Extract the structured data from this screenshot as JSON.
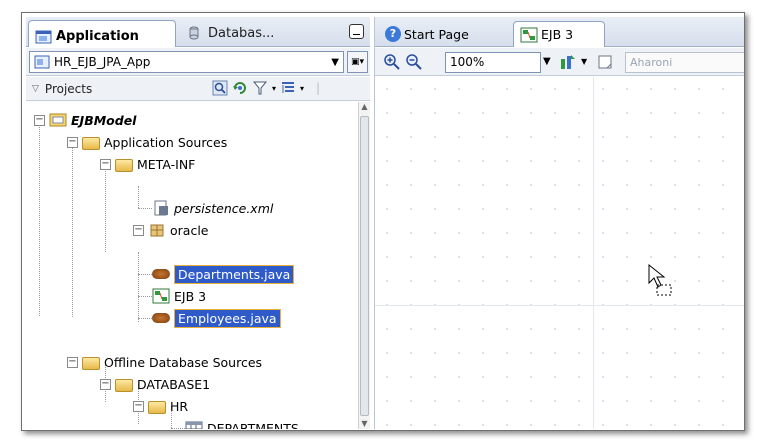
{
  "left_panel": {
    "tabs": [
      {
        "label": "Application",
        "active": true
      },
      {
        "label": "Databas...",
        "active": false
      }
    ],
    "application_select": {
      "value": "HR_EJB_JPA_App"
    },
    "projects_label": "Projects",
    "tree": [
      {
        "label": "EJBModel",
        "depth": 0,
        "expand": "−",
        "icon": "project-icon"
      },
      {
        "label": "Application Sources",
        "depth": 1,
        "expand": "−",
        "icon": "folder-icon"
      },
      {
        "label": "META-INF",
        "depth": 2,
        "expand": "−",
        "icon": "folder-icon"
      },
      {
        "label": "persistence.xml",
        "depth": 3,
        "expand": "",
        "icon": "xml-file-icon"
      },
      {
        "label": "oracle",
        "depth": 2,
        "expand": "−",
        "icon": "package-icon"
      },
      {
        "label": "Departments.java",
        "depth": 3,
        "expand": "",
        "icon": "bean-icon",
        "selected": true
      },
      {
        "label": "EJB 3",
        "depth": 3,
        "expand": "",
        "icon": "diagram-icon"
      },
      {
        "label": "Employees.java",
        "depth": 3,
        "expand": "",
        "icon": "bean-icon",
        "selected": true
      },
      {
        "label": "Offline Database Sources",
        "depth": 1,
        "expand": "−",
        "icon": "folder-icon"
      },
      {
        "label": "DATABASE1",
        "depth": 2,
        "expand": "−",
        "icon": "folder-icon"
      },
      {
        "label": "HR",
        "depth": 3,
        "expand": "−",
        "icon": "folder-icon"
      },
      {
        "label": "DEPARTMENTS",
        "depth": 4,
        "expand": "",
        "icon": "table-icon"
      }
    ]
  },
  "right_panel": {
    "tabs": [
      {
        "label": "Start Page",
        "active": false
      },
      {
        "label": "EJB 3",
        "active": true
      }
    ],
    "zoom": {
      "value": "100%"
    },
    "font": {
      "value": "Aharoni"
    }
  },
  "colors": {
    "selection": "#2e5bc9",
    "selection_border": "#e9b13c",
    "tab_bar": "#d6dfec"
  }
}
